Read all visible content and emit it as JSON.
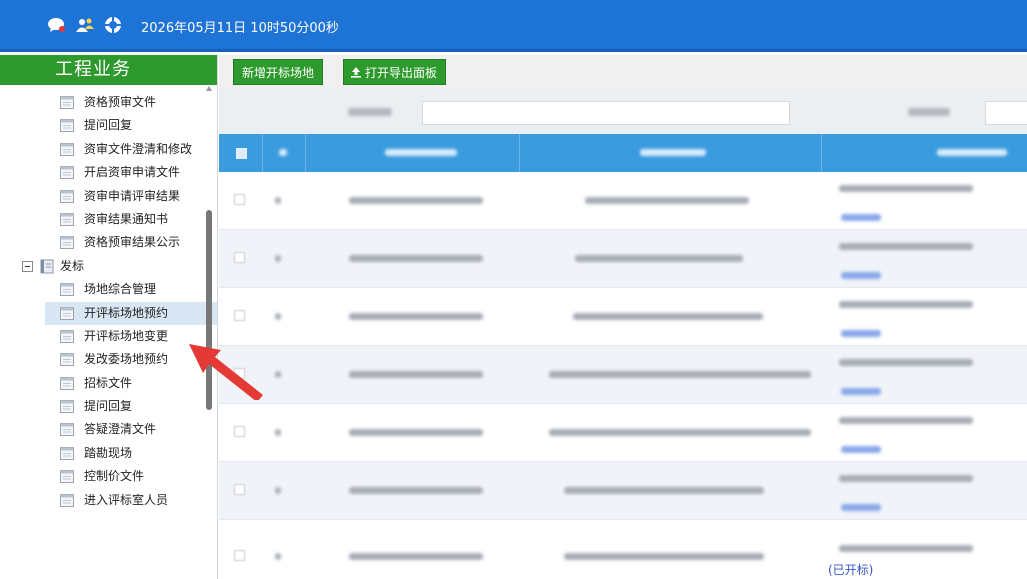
{
  "header": {
    "datetime": "2026年05月11日 10时50分00秒",
    "icons": [
      "chat-icon",
      "users-icon",
      "help-icon"
    ],
    "bg_color": "#1e73d6"
  },
  "sidebar": {
    "title": "工程业务",
    "title_bg": "#2e9a2e",
    "items_before": [
      {
        "label": "资格预审文件"
      },
      {
        "label": "提问回复"
      },
      {
        "label": "资审文件澄清和修改"
      },
      {
        "label": "开启资审申请文件"
      },
      {
        "label": "资审申请评审结果"
      },
      {
        "label": "资审结果通知书"
      },
      {
        "label": "资格预审结果公示"
      }
    ],
    "group": {
      "label": "发标",
      "expanded": true
    },
    "items_after": [
      {
        "label": "场地综合管理"
      },
      {
        "label": "开评标场地预约",
        "active": true
      },
      {
        "label": "开评标场地变更"
      },
      {
        "label": "发改委场地预约"
      },
      {
        "label": "招标文件"
      },
      {
        "label": "提问回复"
      },
      {
        "label": "答疑澄清文件"
      },
      {
        "label": "踏勘现场"
      },
      {
        "label": "控制价文件"
      },
      {
        "label": "进入评标室人员"
      }
    ]
  },
  "toolbar": {
    "add_label": "新增开标场地",
    "export_label": "打开导出面板"
  },
  "table": {
    "last_row_status": "(已开标)",
    "accent": "#3a9bdf"
  }
}
